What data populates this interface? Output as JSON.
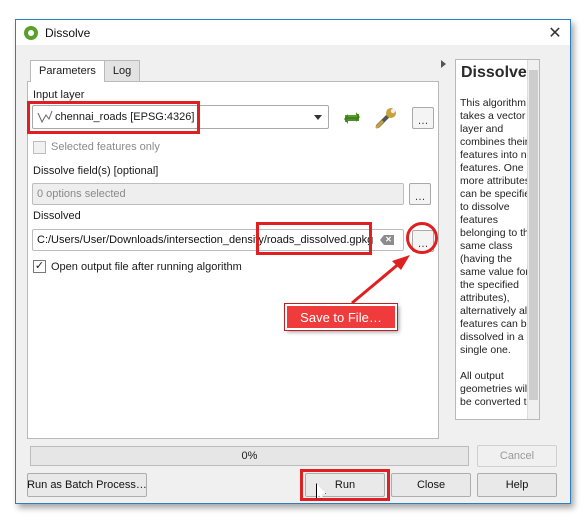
{
  "window": {
    "title": "Dissolve",
    "close_symbol": "✕"
  },
  "tabs": [
    {
      "label": "Parameters",
      "active": true
    },
    {
      "label": "Log",
      "active": false
    }
  ],
  "params": {
    "input_layer_label": "Input layer",
    "input_layer_value": "chennai_roads [EPSG:4326]",
    "selected_only_label": "Selected features only",
    "selected_only_checked": false,
    "dissolve_fields_label": "Dissolve field(s) [optional]",
    "dissolve_fields_value": "0 options selected",
    "dissolved_label": "Dissolved",
    "dissolved_path": "C:/Users/User/Downloads/intersection_density/roads_dissolved.gpkg",
    "open_output_label": "Open output file after running algorithm",
    "open_output_checked": true,
    "browse_label": "…"
  },
  "help": {
    "title": "Dissolve",
    "paragraphs": [
      "This algorithm takes a vector layer and combines their features into new features. One or more attributes can be specified to dissolve features belonging to the same class (having the same value for the specified attributes), alternatively all features can be dissolved in a single one.",
      "All output geometries will be converted to"
    ]
  },
  "progress": {
    "text": "0%",
    "value": 0
  },
  "buttons": {
    "cancel": "Cancel",
    "batch": "Run as Batch Process…",
    "run": "Run",
    "close": "Close",
    "help": "Help"
  },
  "annotation": {
    "callout_text": "Save to File…",
    "color": "#e02020"
  },
  "colors": {
    "accent": "#2c7fc0",
    "highlight": "#e02020",
    "qgis_green": "#5aa02c"
  }
}
